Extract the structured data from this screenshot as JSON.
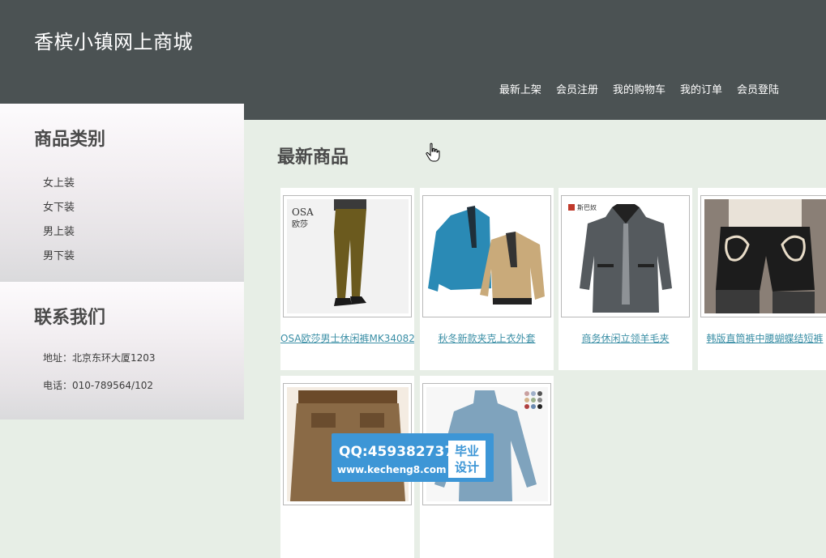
{
  "site": {
    "title": "香槟小镇网上商城"
  },
  "nav": {
    "items": [
      "最新上架",
      "会员注册",
      "我的购物车",
      "我的订单",
      "会员登陆"
    ]
  },
  "sidebar": {
    "categories_title": "商品类别",
    "categories": [
      "女上装",
      "女下装",
      "男上装",
      "男下装"
    ],
    "contact_title": "联系我们",
    "address": "地址：北京东环大厦1203",
    "phone": "电话：010-789564/102"
  },
  "main": {
    "title": "最新商品",
    "products": [
      {
        "name": "OSA欧莎男士休闲裤MK34082",
        "icon": "trousers-photo"
      },
      {
        "name": "秋冬新款夹克上衣外套",
        "icon": "jacket-photo"
      },
      {
        "name": "商务休闲立领羊毛夹",
        "icon": "wool-coat-photo"
      },
      {
        "name": "韩版直筒裤中腰蝴蝶结短裤",
        "icon": "shorts-photo"
      },
      {
        "name": "",
        "icon": "skirt-photo"
      },
      {
        "name": "",
        "icon": "sweater-photo"
      }
    ]
  },
  "watermark": {
    "qq": "QQ:459382737",
    "url": "www.kecheng8.com",
    "badge_line1": "毕业",
    "badge_line2": "设计"
  },
  "colors": {
    "header_bg": "#4b5253",
    "page_bg": "#e7eee6",
    "link": "#3b8fa6",
    "watermark_bg": "#3d96d6"
  }
}
